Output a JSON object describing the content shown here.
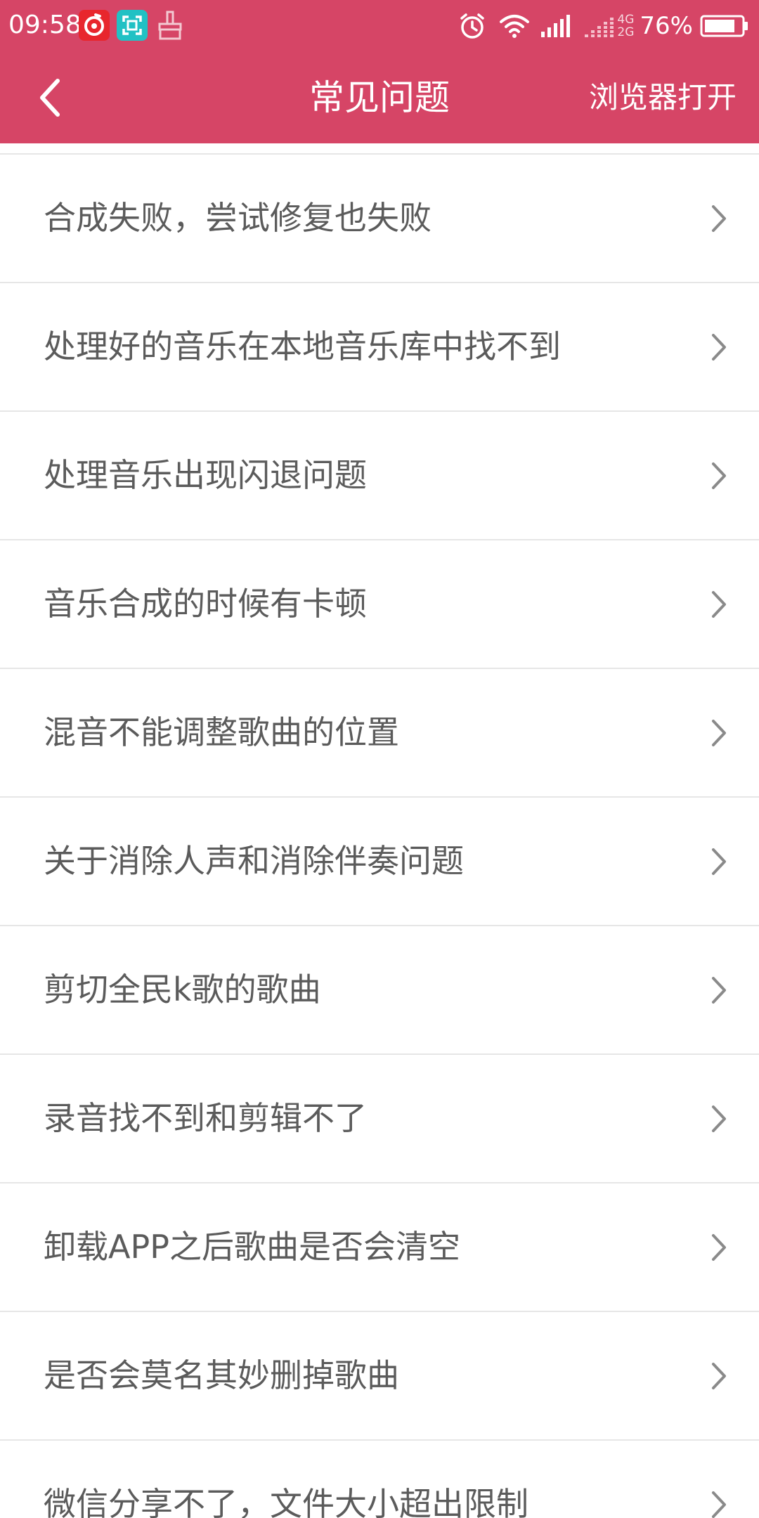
{
  "status_bar": {
    "time": "09:58",
    "net_label_top": "4G",
    "net_label_bottom": "2G",
    "battery_percent": "76%",
    "icons": [
      "netease-music-icon",
      "scan-app-icon",
      "cleaner-app-icon",
      "alarm-icon",
      "wifi-icon",
      "signal-icon",
      "signal-secondary-icon",
      "battery-icon"
    ]
  },
  "header": {
    "back_icon": "chevron-left-icon",
    "title": "常见问题",
    "browser_open": "浏览器打开"
  },
  "faq": {
    "chevron_icon": "chevron-right-icon",
    "items": [
      {
        "label": "合成失败，尝试修复也失败"
      },
      {
        "label": "处理好的音乐在本地音乐库中找不到"
      },
      {
        "label": "处理音乐出现闪退问题"
      },
      {
        "label": "音乐合成的时候有卡顿"
      },
      {
        "label": "混音不能调整歌曲的位置"
      },
      {
        "label": "关于消除人声和消除伴奏问题"
      },
      {
        "label": "剪切全民k歌的歌曲"
      },
      {
        "label": "录音找不到和剪辑不了"
      },
      {
        "label": "卸载APP之后歌曲是否会清空"
      },
      {
        "label": "是否会莫名其妙删掉歌曲"
      },
      {
        "label": "微信分享不了，文件大小超出限制"
      }
    ]
  },
  "colors": {
    "header_bg": "#d64566",
    "text": "#5b5b5b",
    "divider": "#e6e6e6",
    "chevron": "#8a8a8a"
  }
}
